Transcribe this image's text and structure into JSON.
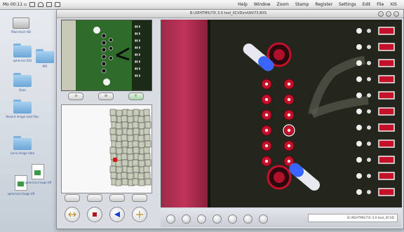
{
  "menubar": {
    "clock": "Mo 00:11 ▫",
    "menus": [
      "Help",
      "Window",
      "Zoom",
      "Stamp",
      "Register",
      "Settings",
      "Edit",
      "File",
      "XIS"
    ]
  },
  "desktop": {
    "icons": [
      {
        "kind": "drive",
        "label": "Macintosh HD"
      },
      {
        "kind": "folder",
        "label": "spherical 002"
      },
      {
        "kind": "folder",
        "label": "Data"
      },
      {
        "kind": "folder",
        "label": "Recent image hold files"
      },
      {
        "kind": "folder",
        "label": "Leica image data"
      },
      {
        "kind": "folder",
        "label": "WU"
      },
      {
        "kind": "doc",
        "label": "spherical image tiff"
      },
      {
        "kind": "doc",
        "label": "spherical image tiff"
      }
    ]
  },
  "window": {
    "title": "B:\\XEHTMS\\73\\ 3.0 tool_XCVD\\ml\\NV73.BXS",
    "thumb_buttons": [
      "",
      "",
      ""
    ],
    "nav_buttons": [
      {
        "name": "scroll-left-button",
        "icon": "double-arrow-icon"
      },
      {
        "name": "stop-button",
        "icon": "stop-icon"
      },
      {
        "name": "play-button",
        "icon": "play-icon"
      },
      {
        "name": "move-button",
        "icon": "cross-arrows-icon"
      }
    ],
    "tool_buttons_count": 7,
    "status_text": "B:\\XEHTMS\\73\\ 3.0 tool_XCVD"
  },
  "colors": {
    "pcb_green": "#2f6b2a",
    "pad_red": "#c4112a",
    "highlight_blue": "#3a64ff",
    "pink_strip": "#c0345a",
    "play_blue": "#1a3ad8",
    "stop_red": "#b01818",
    "accent_green": "#a8d5a8"
  }
}
